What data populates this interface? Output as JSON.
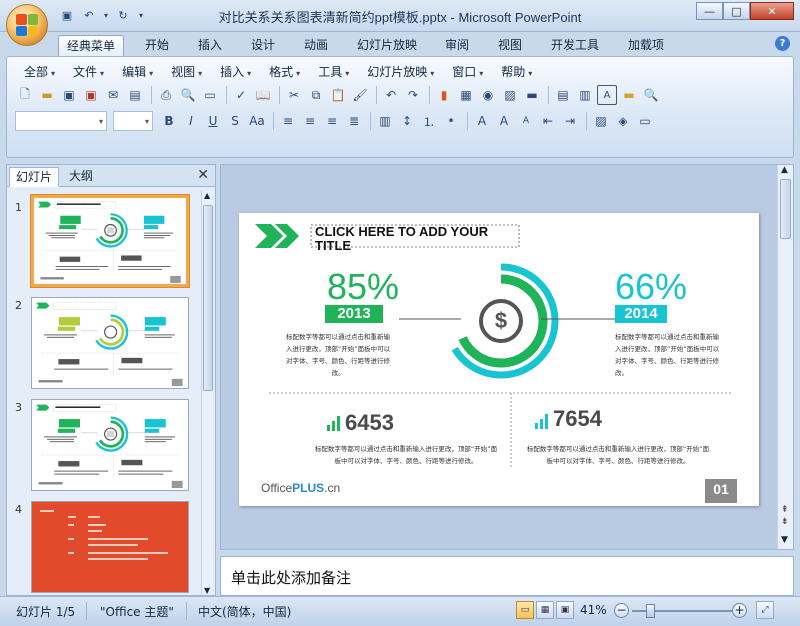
{
  "window": {
    "title": "对比关系关系图表清新简约ppt模板.pptx - Microsoft PowerPoint",
    "min_label": "—",
    "max_label": "□",
    "close_label": "✕"
  },
  "ribbon_tabs": [
    "经典菜单",
    "开始",
    "插入",
    "设计",
    "动画",
    "幻灯片放映",
    "审阅",
    "视图",
    "开发工具",
    "加载项"
  ],
  "menu_bar": [
    "全部",
    "文件",
    "编辑",
    "视图",
    "插入",
    "格式",
    "工具",
    "幻灯片放映",
    "窗口",
    "帮助"
  ],
  "left_panel": {
    "tabs": [
      "幻灯片",
      "大纲"
    ],
    "close_label": "✕",
    "slides": [
      {
        "num": "1",
        "selected": true
      },
      {
        "num": "2",
        "selected": false
      },
      {
        "num": "3",
        "selected": false
      },
      {
        "num": "4",
        "selected": false
      }
    ]
  },
  "slide": {
    "title": "CLICK HERE TO ADD YOUR TITLE",
    "left_pct": "85%",
    "left_year": "2013",
    "left_text": "标配数字等都可以通过点击和重新输入进行更改，顶部“开始”面板中可以对字体、字号、颜色、行距等进行修改。",
    "right_pct": "66%",
    "right_year": "2014",
    "right_text": "标配数字等都可以通过点击和重新输入进行更改，顶部“开始”面板中可以对字体、字号、颜色、行距等进行修改。",
    "stat_left": "6453",
    "stat_left_text": "标配数字等都可以通过点击和重新输入进行更改，顶部“开始”面板中可以对字体、字号、颜色、行距等进行修改。",
    "stat_right": "7654",
    "stat_right_text": "标配数字等都可以通过点击和重新输入进行更改，顶部“开始”面板中可以对字体、字号、颜色、行距等进行修改。",
    "logo_pre": "Office",
    "logo_bold": "PLUS",
    "logo_post": ".cn",
    "page_num": "01",
    "center_symbol": "$"
  },
  "thumb_labels": {
    "left_pct": "85%",
    "right_pct": "66%",
    "left_year": "2013",
    "right_year": "2014",
    "stat_left": "6453",
    "stat_right": "7654"
  },
  "notes_placeholder": "单击此处添加备注",
  "status": {
    "slide_info": "幻灯片 1/5",
    "theme": "\"Office 主题\"",
    "language": "中文(简体，中国)",
    "zoom": "41%"
  },
  "colors": {
    "green": "#1fb45a",
    "teal": "#19c4d2",
    "dark": "#333333"
  }
}
